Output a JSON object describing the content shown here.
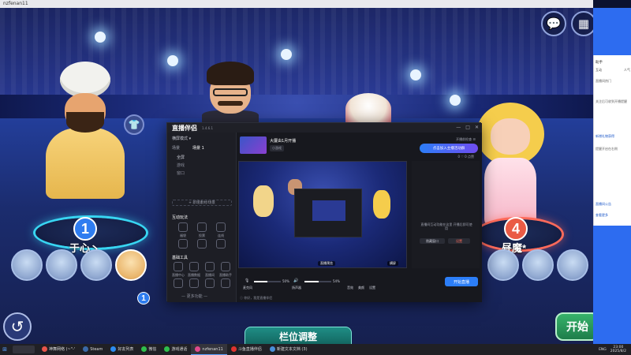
{
  "game": {
    "window_title": "nzfenan11",
    "players": [
      {
        "slot": "1",
        "name": "于心丶"
      },
      {
        "slot": "4",
        "name": "昼魔*"
      }
    ],
    "selected_portrait_badge": "1",
    "slot_adjust_label": "栏位调整",
    "start_label": "开始",
    "icons": {
      "back": "undo-arrow-icon",
      "chat": "chat-heart-icon",
      "menu": "grid-menu-icon",
      "wardrobe": "shirt-icon"
    }
  },
  "stream_app": {
    "title": "直播伴侣",
    "version": "1.4.6.1",
    "left": {
      "mode": "横屏模式 ▾",
      "scene_tabs": [
        "场景",
        "场景 1"
      ],
      "sources": [
        "全屏",
        "游戏",
        "窗口"
      ],
      "add_scene": "+ 新增素材/场景",
      "interaction_title": "互动玩法",
      "tools_title": "基础工具",
      "interaction_items": [
        "福袋",
        "投票",
        "连线",
        "主题",
        "礼物",
        "红包"
      ],
      "tool_items": [
        "直播中心",
        "直播数据",
        "直播间",
        "直播助手",
        "美颜",
        "声音",
        "滤镜",
        "字幕"
      ],
      "more": "— 更多功能 —"
    },
    "room": {
      "title": "大厦由1月开播",
      "tag": "小游戏",
      "header_right": "开播前检查   ☰",
      "promo": "点击加入主播活动群",
      "stats": "0 ♡   0 点赞"
    },
    "preview": {
      "label": "直播预览",
      "corner": "横屏"
    },
    "right_panel": {
      "text": "直播间互动功能在这里 开播后即可使用",
      "btn_a": "隐藏窗口",
      "btn_b": "设置"
    },
    "bottom": {
      "mic_label": "麦克风",
      "mic_value": "50%",
      "mic_level": 0.5,
      "spk_label": "扬声器",
      "spk_value": "54%",
      "spk_level": 0.54,
      "icons": [
        "音效",
        "美颜",
        "设置"
      ],
      "go_live": "开始直播",
      "footer": "ⓘ 你好，我是直播伴侣"
    }
  },
  "side_panel": {
    "header": "助手",
    "tabs": [
      "互动",
      "人气"
    ],
    "lines": [
      {
        "text": "直播间热门",
        "hl": false
      },
      {
        "text": "关注后可收到开播提醒",
        "hl": false
      },
      {
        "text": "新增礼物获得",
        "hl": true
      },
      {
        "text": "提醒开启在右侧",
        "hl": false
      },
      {
        "text": "直播间公告",
        "hl": true
      },
      {
        "text": "查看更多",
        "hl": true
      }
    ]
  },
  "taskbar": {
    "items": [
      {
        "label": "神舞网络 (~\"-'",
        "color": "#e8554b",
        "active": false
      },
      {
        "label": "Steam",
        "color": "#3b6aa8",
        "active": false
      },
      {
        "label": "好友列表",
        "color": "#2d8cf0",
        "active": false
      },
      {
        "label": "微信",
        "color": "#2fbf4c",
        "active": false
      },
      {
        "label": "游戏通话",
        "color": "#2fbf4c",
        "active": false
      },
      {
        "label": "nzfenan11",
        "color": "#e04a8d",
        "active": true
      },
      {
        "label": "斗鱼直播伴侣",
        "color": "#e0332f",
        "active": false
      },
      {
        "label": "新建文本文档 (3)",
        "color": "#4a8fd8",
        "active": false
      }
    ],
    "tray": "ENG",
    "time": "23:00",
    "date": "2025/8/2"
  }
}
